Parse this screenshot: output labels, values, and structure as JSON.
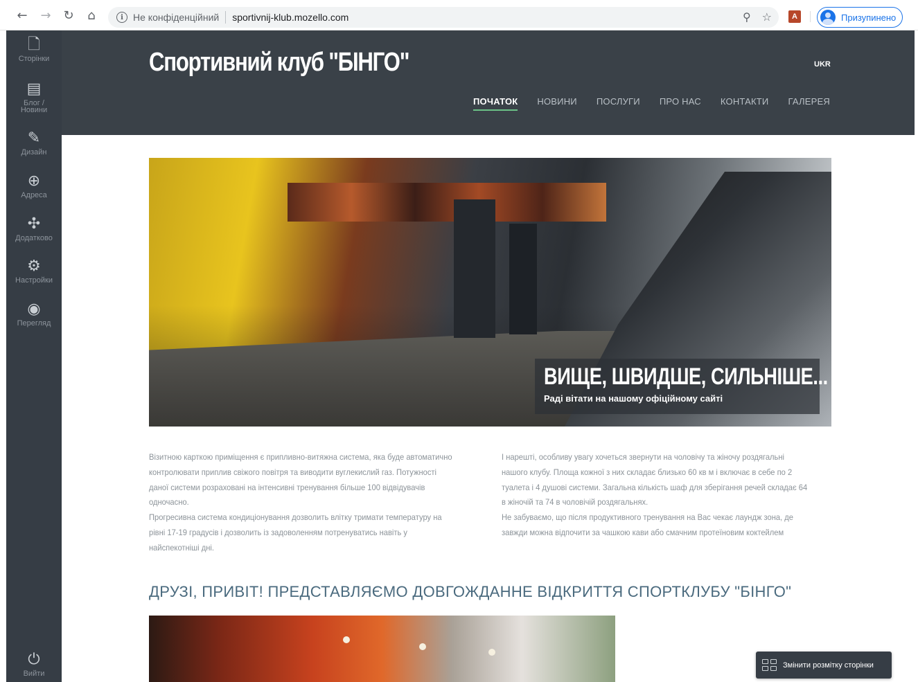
{
  "browser": {
    "security_label": "Не конфіденційний",
    "url": "sportivnij-klub.mozello.com",
    "profile_label": "Призупинено"
  },
  "editor": {
    "items": [
      {
        "label": "Сторінки",
        "icon": "page-add-icon"
      },
      {
        "label": "Блог / Новини",
        "icon": "blog-icon"
      },
      {
        "label": "Дизайн",
        "icon": "design-brush-icon"
      },
      {
        "label": "Адреса",
        "icon": "globe-icon"
      },
      {
        "label": "Додатково",
        "icon": "puzzle-icon"
      },
      {
        "label": "Настройки",
        "icon": "gear-icon"
      },
      {
        "label": "Перегляд",
        "icon": "eye-icon"
      }
    ],
    "logout_label": "Вийти"
  },
  "site": {
    "title": "Спортивний клуб \"БІНГО\"",
    "language": "UKR",
    "nav": [
      "ПОЧАТОК",
      "НОВИНИ",
      "ПОСЛУГИ",
      "ПРО НАС",
      "КОНТАКТИ",
      "ГАЛЕРЕЯ"
    ],
    "active_nav": "ПОЧАТОК",
    "accent_color": "#6bc187"
  },
  "hero": {
    "title": "ВИЩЕ, ШВИДШЕ, СИЛЬНІШЕ...",
    "subtitle": "Раді вітати на нашому офіційному сайті"
  },
  "content": {
    "left_paragraphs": [
      "Візитною карткою приміщення є припливно-витяжна система, яка буде автоматично контролювати приплив свіжого повітря та виводити вуглекислий газ. Потужності даної системи розраховані на інтенсивні тренування більше 100 відвідувачів одночасно.",
      "Прогресивна система кондиціонування дозволить влітку тримати температуру на рівні 17-19 градусів і дозволить із задоволенням потренуватись навіть у найспекотніші дні."
    ],
    "right_paragraphs": [
      "І нарешті, особливу увагу хочеться звернути на чоловічу та жіночу роздягальні нашого клубу. Площа кожної з них складає близько 60 кв м і включає в себе по 2 туалета і 4 душові системи. Загальна кількість шаф для зберігання речей складає 64 в жіночій та 74 в чоловічій роздягальнях.",
      "Не забуваємо, що після продуктивного тренування на Вас чекає лаундж зона, де завжди можна відпочити за чашкою кави або смачним протеїновим коктейлем"
    ],
    "section_title": "ДРУЗІ, ПРИВІТ! ПРЕДСТАВЛЯЄМО ДОВГОЖДАННЕ ВІДКРИТТЯ СПОРТКЛУБУ \"БІНГО\""
  },
  "layout_button": {
    "label": "Змінити розмітку сторінки"
  }
}
